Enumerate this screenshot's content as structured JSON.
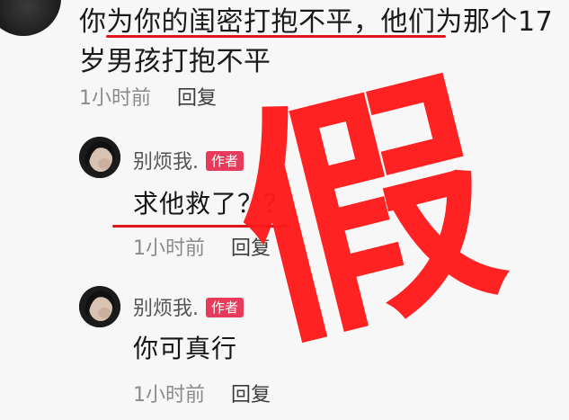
{
  "main_comment": {
    "text": "你为你的闺密打抱不平，他们为那个17岁男孩打抱不平",
    "time": "1小时前",
    "reply_label": "回复"
  },
  "replies": [
    {
      "author": "别烦我.",
      "badge": "作者",
      "text": "求他救了？？",
      "time": "1小时前",
      "reply_label": "回复"
    },
    {
      "author": "别烦我.",
      "badge": "作者",
      "text": "你可真行",
      "time": "1小时前",
      "reply_label": "回复"
    }
  ],
  "overlay": {
    "stamp_text": "假",
    "stamp_color": "#ff1a1a",
    "underline_color": "#e0141a"
  },
  "colors": {
    "badge_bg": "#e83a5a",
    "meta_gray": "#8a8a8a"
  }
}
